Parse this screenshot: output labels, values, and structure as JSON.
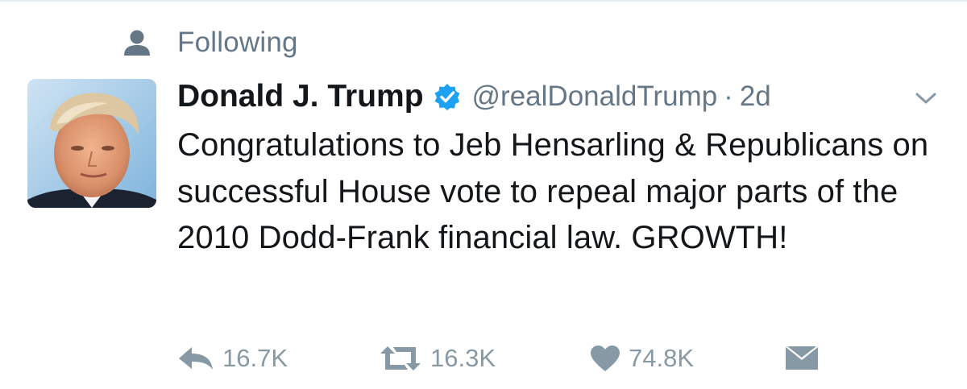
{
  "context": {
    "label": "Following",
    "icon": "person-icon"
  },
  "tweet": {
    "display_name": "Donald J. Trump",
    "verified_icon": "verified-badge-icon",
    "handle": "@realDonaldTrump",
    "separator": "·",
    "timestamp": "2d",
    "menu_icon": "chevron-down-icon",
    "text": "Congratulations to Jeb Hensarling & Republicans on successful House vote to repeal major parts of the 2010 Dodd-Frank financial law. GROWTH!"
  },
  "actions": {
    "reply": {
      "icon": "reply-icon",
      "count": "16.7K"
    },
    "retweet": {
      "icon": "retweet-icon",
      "count": "16.3K"
    },
    "like": {
      "icon": "heart-icon",
      "count": "74.8K"
    },
    "message": {
      "icon": "envelope-icon"
    }
  },
  "colors": {
    "text": "#14171a",
    "secondary": "#657786",
    "action": "#8899a6",
    "verified": "#1da1f2"
  }
}
